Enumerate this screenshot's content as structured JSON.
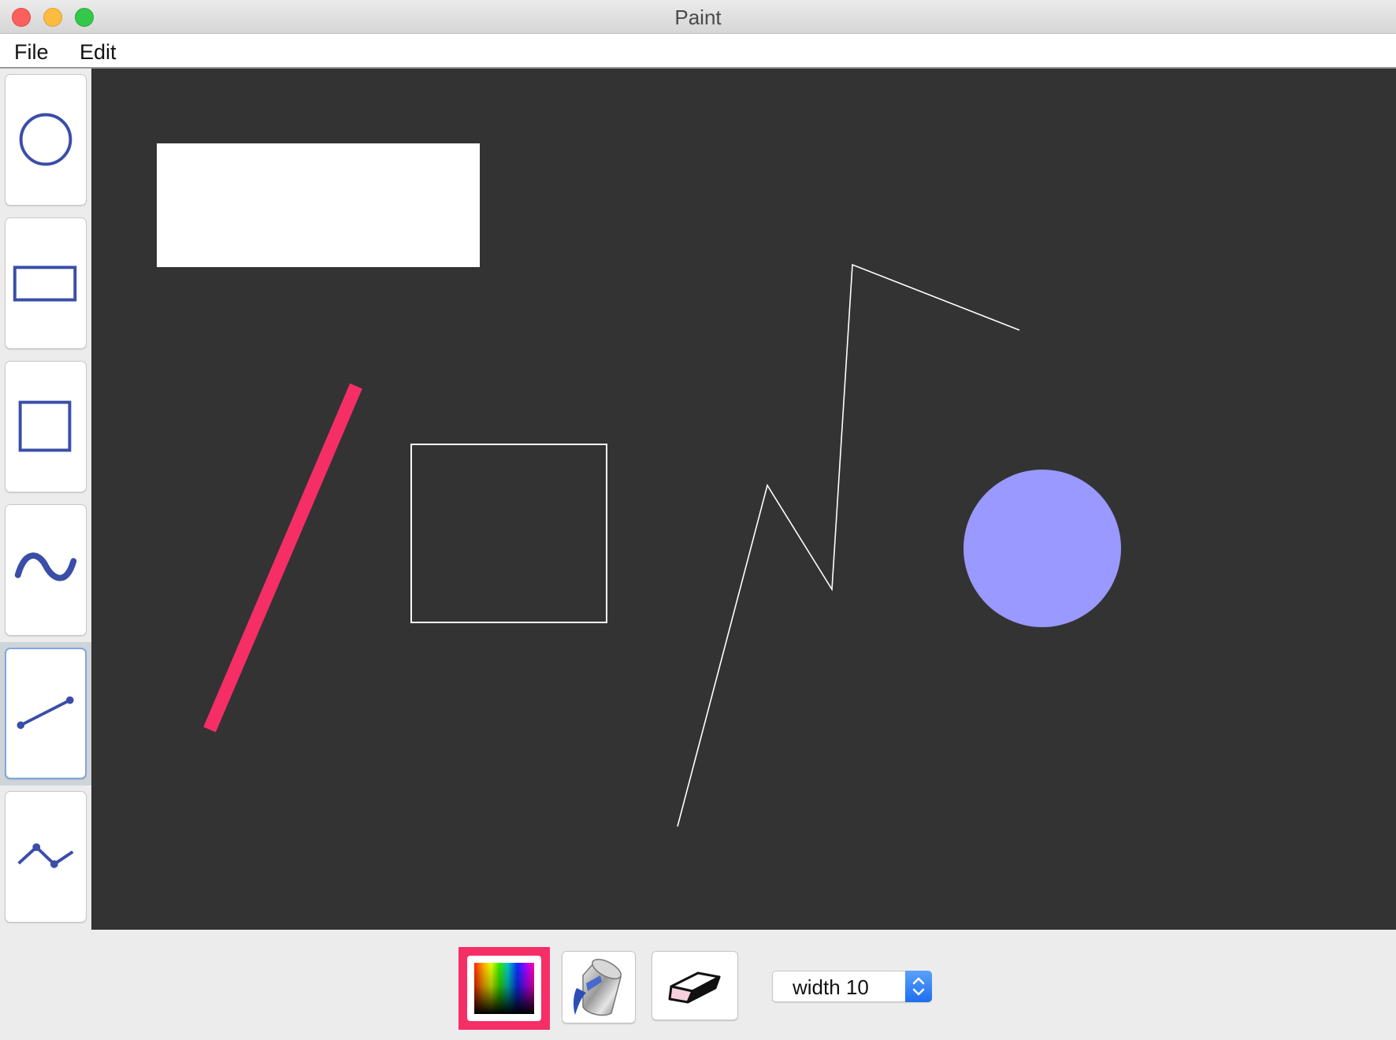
{
  "window": {
    "title": "Paint"
  },
  "menu": {
    "items": [
      {
        "label": "File"
      },
      {
        "label": "Edit"
      }
    ]
  },
  "tools": [
    {
      "name": "circle-tool",
      "icon": "circle-icon",
      "selected": false
    },
    {
      "name": "rectangle-tool",
      "icon": "rectangle-icon",
      "selected": false
    },
    {
      "name": "square-tool",
      "icon": "square-icon",
      "selected": false
    },
    {
      "name": "freehand-tool",
      "icon": "freehand-curve-icon",
      "selected": false
    },
    {
      "name": "line-tool",
      "icon": "line-icon",
      "selected": true
    },
    {
      "name": "polyline-tool",
      "icon": "polyline-icon",
      "selected": false
    }
  ],
  "canvas": {
    "background": "#333333",
    "shapes": [
      {
        "type": "filled-rectangle",
        "color": "#ffffff"
      },
      {
        "type": "thick-line",
        "color": "#f52e66",
        "stroke_width": 10
      },
      {
        "type": "outlined-square",
        "color": "#ffffff"
      },
      {
        "type": "polyline",
        "color": "#ffffff"
      },
      {
        "type": "filled-circle",
        "color": "#9999ff"
      }
    ]
  },
  "bottom_toolbar": {
    "color_picker": {
      "icon": "color-spectrum-icon",
      "selected_color": "#f52e66"
    },
    "fill_tool": {
      "icon": "paint-bucket-icon"
    },
    "eraser_tool": {
      "icon": "eraser-icon"
    },
    "width_select": {
      "label": "width 10"
    }
  },
  "colors": {
    "accent": "#f52e66",
    "tool_icon": "#3a4ea8",
    "selection_border": "#7fa8de"
  }
}
